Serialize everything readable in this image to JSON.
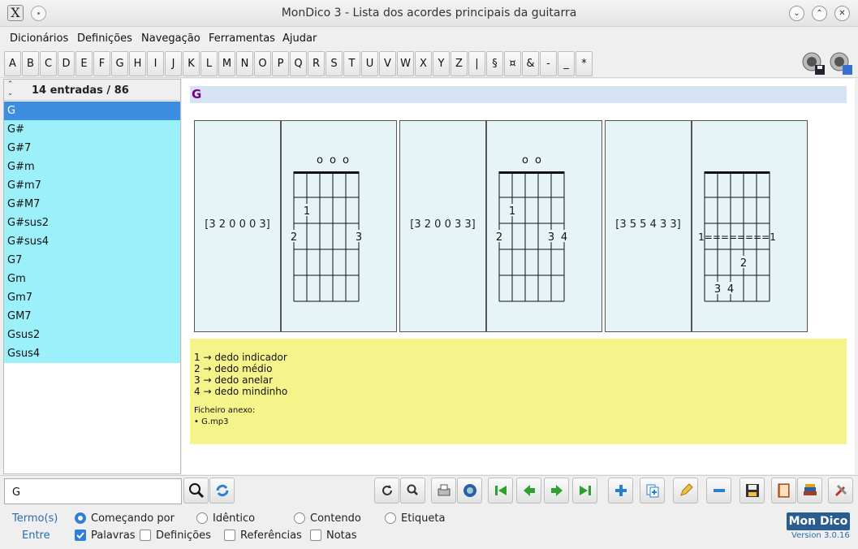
{
  "window": {
    "title": "MonDico 3 - Lista dos acordes principais da guitarra"
  },
  "menu": [
    "Dicionários",
    "Definições",
    "Navegação",
    "Ferramentas",
    "Ajudar"
  ],
  "alphabet": [
    "A",
    "B",
    "C",
    "D",
    "E",
    "F",
    "G",
    "H",
    "I",
    "J",
    "K",
    "L",
    "M",
    "N",
    "O",
    "P",
    "Q",
    "R",
    "S",
    "T",
    "U",
    "V",
    "W",
    "X",
    "Y",
    "Z",
    "|",
    "§",
    "¤",
    "&",
    "-",
    "_",
    "*"
  ],
  "list": {
    "count": "14 entradas / 86",
    "entries": [
      "G",
      "G#",
      "G#7",
      "G#m",
      "G#m7",
      "G#M7",
      "G#sus2",
      "G#sus4",
      "G7",
      "Gm",
      "Gm7",
      "GM7",
      "Gsus2",
      "Gsus4"
    ],
    "selected": "G"
  },
  "content": {
    "title": "G",
    "chords": [
      {
        "code": "[3 2 0 0 0 3]",
        "open": [
          null,
          null,
          "o",
          "o",
          "o",
          null
        ],
        "fingers": [
          {
            "string": 0,
            "fret": 3,
            "label": "2"
          },
          {
            "string": 1,
            "fret": 2,
            "label": "1"
          },
          {
            "string": 5,
            "fret": 3,
            "label": "3"
          }
        ],
        "barre": null
      },
      {
        "code": "[3 2 0 0 3 3]",
        "open": [
          null,
          null,
          "o",
          "o",
          null,
          null
        ],
        "fingers": [
          {
            "string": 0,
            "fret": 3,
            "label": "2"
          },
          {
            "string": 1,
            "fret": 2,
            "label": "1"
          },
          {
            "string": 4,
            "fret": 3,
            "label": "3"
          },
          {
            "string": 5,
            "fret": 3,
            "label": "4"
          }
        ],
        "barre": null
      },
      {
        "code": "[3 5 5 4 3 3]",
        "open": [
          null,
          null,
          null,
          null,
          null,
          null
        ],
        "fingers": [
          {
            "string": 3,
            "fret": 4,
            "label": "2"
          },
          {
            "string": 1,
            "fret": 5,
            "label": "3"
          },
          {
            "string": 2,
            "fret": 5,
            "label": "4"
          }
        ],
        "barre": {
          "fret": 3,
          "text": "1========1"
        }
      }
    ],
    "legend": [
      "1 → dedo indicador",
      "2 → dedo médio",
      "3 → dedo anelar",
      "4 → dedo mindinho"
    ],
    "attachment_label": "Ficheiro anexo:",
    "attachment_file": "• G.mp3"
  },
  "search": {
    "value": "G"
  },
  "options": {
    "term_label": "Termo(s)",
    "between_label": "Entre",
    "match": [
      {
        "label": "Começando por",
        "checked": true
      },
      {
        "label": "Idêntico",
        "checked": false
      },
      {
        "label": "Contendo",
        "checked": false
      },
      {
        "label": "Etiqueta",
        "checked": false
      }
    ],
    "fields": [
      {
        "label": "Palavras",
        "checked": true
      },
      {
        "label": "Definições",
        "checked": false
      },
      {
        "label": "Referências",
        "checked": false
      },
      {
        "label": "Notas",
        "checked": false
      }
    ]
  },
  "brand": {
    "logo": "Mon Dico",
    "version": "Version 3.0.16"
  },
  "colors": {
    "list_bg": "#9bf0fa",
    "selected": "#3d8ee0",
    "title_fg": "#7a007a",
    "legend_bg": "#f5f48a",
    "accent": "#2f7fd8"
  }
}
